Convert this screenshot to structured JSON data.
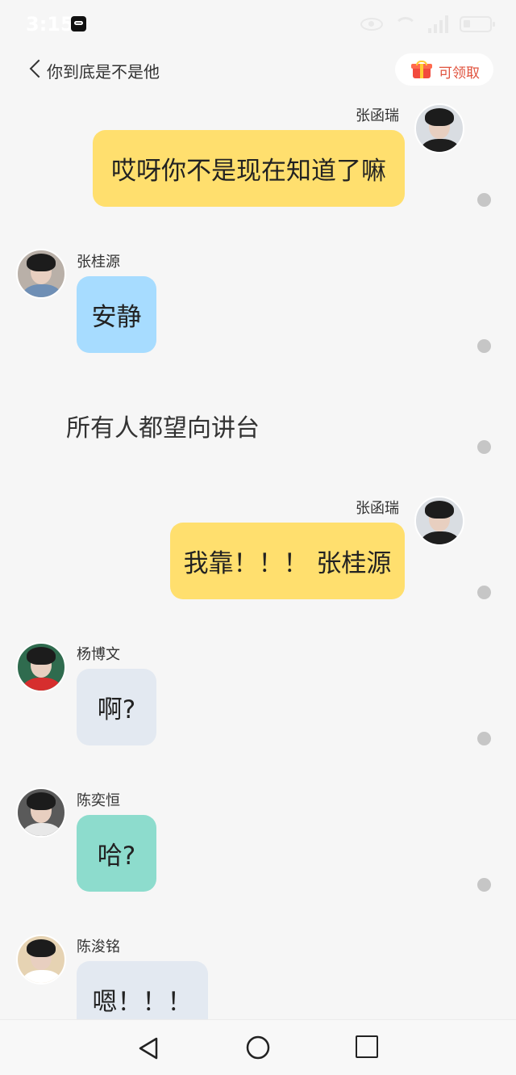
{
  "status_bar": {
    "time": "3:15"
  },
  "header": {
    "back_icon": "chevron-left-icon",
    "title": "你到底是不是他",
    "claim_button": {
      "icon": "gift-icon",
      "label": "可领取"
    }
  },
  "messages": [
    {
      "sender": "张函瑞",
      "side": "right",
      "text": "哎呀你不是现在知道了嘛",
      "bubble_color": "#ffdf6e"
    },
    {
      "sender": "张桂源",
      "side": "left",
      "text": "安静",
      "bubble_color": "#a7dcff"
    },
    {
      "narration": "所有人都望向讲台"
    },
    {
      "sender": "张函瑞",
      "side": "right",
      "text": "我靠！！！ 张桂源",
      "bubble_color": "#ffdf6e"
    },
    {
      "sender": "杨博文",
      "side": "left",
      "text": "啊?",
      "bubble_color": "#e3e9f1"
    },
    {
      "sender": "陈奕恒",
      "side": "left",
      "text": "哈?",
      "bubble_color": "#8ddccd"
    },
    {
      "sender": "陈浚铭",
      "side": "left",
      "text": "嗯！！！",
      "bubble_color": "#e3e9f1"
    }
  ],
  "nav": {
    "back_icon": "triangle-back-icon",
    "home_icon": "circle-home-icon",
    "recent_icon": "square-recent-icon"
  },
  "colors": {
    "background": "#f6f6f6",
    "accent": "#e0523d",
    "dot": "#c6c6c6"
  }
}
